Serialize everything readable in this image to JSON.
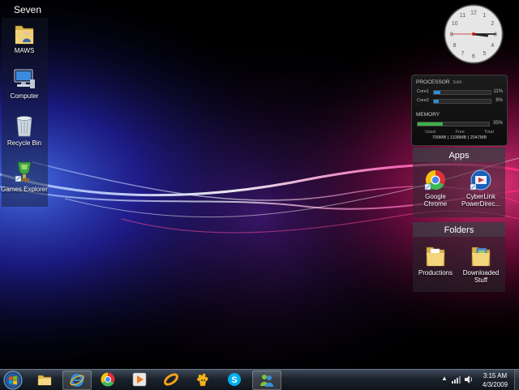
{
  "desktop": {
    "left_fence_title": "Seven",
    "left_icons": [
      {
        "label": "MAWS",
        "icon": "user-folder-icon"
      },
      {
        "label": "Computer",
        "icon": "computer-icon"
      },
      {
        "label": "Recycle Bin",
        "icon": "recycle-bin-icon"
      },
      {
        "label": "Games Explorer",
        "icon": "games-explorer-icon"
      }
    ],
    "apps_fence": {
      "title": "Apps",
      "items": [
        {
          "label": "Google Chrome",
          "icon": "chrome-icon"
        },
        {
          "label": "CyberLink PowerDirec...",
          "icon": "powerdirector-icon"
        }
      ]
    },
    "folders_fence": {
      "title": "Folders",
      "items": [
        {
          "label": "Productions",
          "icon": "folder-icon"
        },
        {
          "label": "Downloaded Stuff",
          "icon": "folder-icon"
        }
      ]
    }
  },
  "clock_gadget": {
    "hour": 3,
    "minute": 15,
    "second": 45
  },
  "meter_gadget": {
    "processor_label": "PROCESSOR",
    "arch": "2x64",
    "cores": [
      {
        "label": "Core1",
        "percent": 11,
        "percent_text": "11%"
      },
      {
        "label": "Core2",
        "percent": 8,
        "percent_text": "8%"
      }
    ],
    "memory_label": "MEMORY",
    "memory_percent": 35,
    "memory_percent_text": "35%",
    "used_caption": "Used",
    "free_caption": "Free",
    "total_caption": "Total",
    "stats_line": "709MB | 1338MB | 2047MB"
  },
  "taskbar": {
    "items": [
      {
        "name": "windows-explorer",
        "icon": "folder-icon",
        "active": false
      },
      {
        "name": "internet-explorer",
        "icon": "ie-icon",
        "active": true
      },
      {
        "name": "google-chrome",
        "icon": "chrome-icon",
        "active": false
      },
      {
        "name": "media-player",
        "icon": "media-player-icon",
        "active": false
      },
      {
        "name": "nero",
        "icon": "nero-icon",
        "active": false
      },
      {
        "name": "fl-studio",
        "icon": "fl-studio-icon",
        "active": false
      },
      {
        "name": "skype",
        "icon": "skype-icon",
        "active": false
      },
      {
        "name": "messenger",
        "icon": "messenger-icon",
        "active": true
      }
    ],
    "time": "3:15 AM",
    "date": "4/3/2009"
  },
  "colors": {
    "accent_blue": "#2a8fd8",
    "memory_green": "#3fb04a",
    "wallpaper_pink": "#e0208a",
    "wallpaper_purple": "#6a1fb0"
  }
}
